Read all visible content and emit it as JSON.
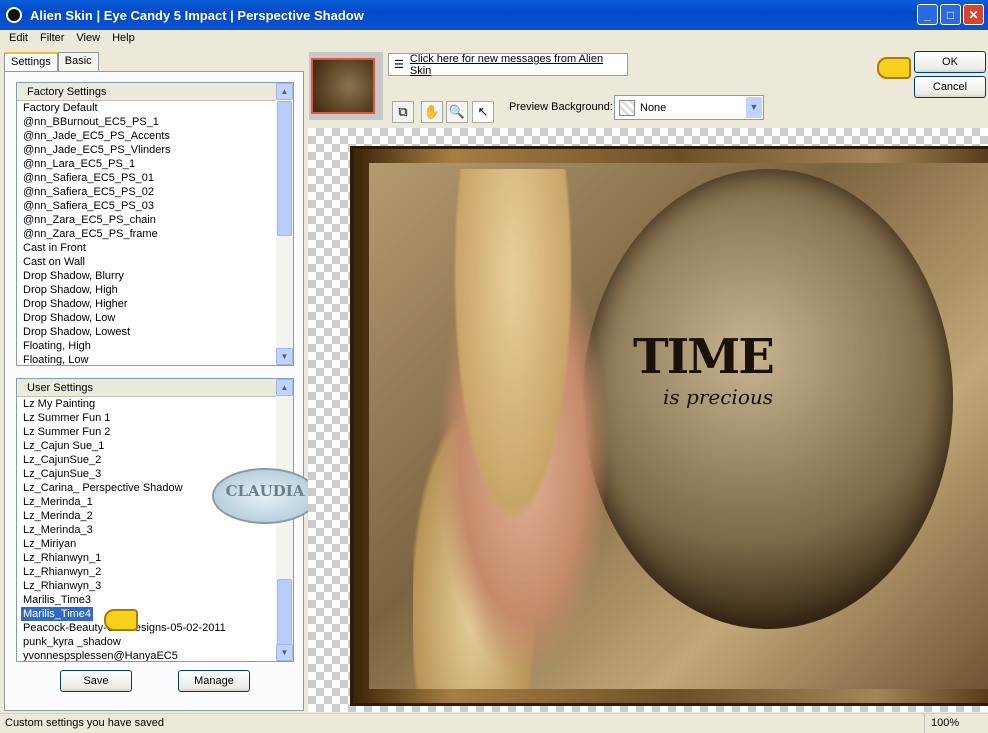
{
  "window": {
    "title": "Alien Skin | Eye Candy 5 Impact | Perspective Shadow",
    "controls": [
      "minimize",
      "maximize",
      "close"
    ]
  },
  "menu": [
    "Edit",
    "Filter",
    "View",
    "Help"
  ],
  "tabs": [
    "Settings",
    "Basic"
  ],
  "factory": {
    "header": "Factory Settings",
    "items": [
      "Factory Default",
      "@nn_BBurnout_EC5_PS_1",
      "@nn_Jade_EC5_PS_Accents",
      "@nn_Jade_EC5_PS_Vlinders",
      "@nn_Lara_EC5_PS_1",
      "@nn_Safiera_EC5_PS_01",
      "@nn_Safiera_EC5_PS_02",
      "@nn_Safiera_EC5_PS_03",
      "@nn_Zara_EC5_PS_chain",
      "@nn_Zara_EC5_PS_frame",
      "Cast in Front",
      "Cast on Wall",
      "Drop Shadow, Blurry",
      "Drop Shadow, High",
      "Drop Shadow, Higher",
      "Drop Shadow, Low",
      "Drop Shadow, Lowest",
      "Floating, High",
      "Floating, Low"
    ]
  },
  "user": {
    "header": "User Settings",
    "selected": "Marilis_Time4",
    "items": [
      "Lz My Painting",
      "Lz Summer Fun 1",
      "Lz Summer Fun 2",
      "Lz_Cajun Sue_1",
      "Lz_CajunSue_2",
      "Lz_CajunSue_3",
      "Lz_Carina_ Perspective Shadow",
      "Lz_Merinda_1",
      "Lz_Merinda_2",
      "Lz_Merinda_3",
      "Lz_Miriyan",
      "Lz_Rhianwyn_1",
      "Lz_Rhianwyn_2",
      "Lz_Rhianwyn_3",
      "Marilis_Time3",
      "Marilis_Time4",
      "Peacock-Beauty-CG-Designs-05-02-2011",
      "punk_kyra _shadow",
      "yvonnespsplessen@HanyaEC5"
    ]
  },
  "buttons": {
    "save": "Save",
    "manage": "Manage",
    "ok": "OK",
    "cancel": "Cancel"
  },
  "messages_link": "Click here for new messages from Alien Skin",
  "preview_background": {
    "label": "Preview Background:",
    "value": "None"
  },
  "tools": [
    "preview-toggle-icon",
    "hand-icon",
    "zoom-icon",
    "arrow-icon"
  ],
  "preview_text": {
    "title": "TIME",
    "subtitle": "is precious"
  },
  "watermark": "CLAUDIA",
  "status": {
    "text": "Custom settings you have saved",
    "zoom": "100%"
  }
}
